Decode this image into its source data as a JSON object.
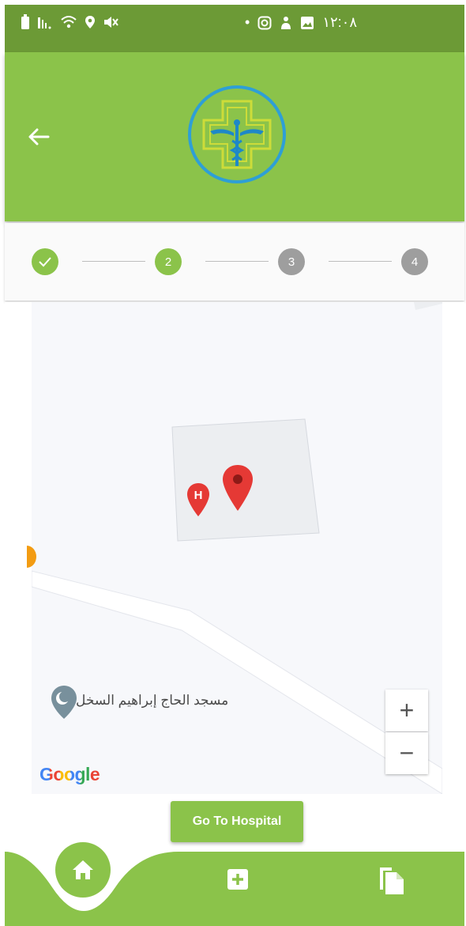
{
  "status_bar": {
    "time": "١٢:٠٨",
    "dot": "•"
  },
  "stepper": {
    "steps": [
      {
        "label": "",
        "state": "completed"
      },
      {
        "label": "2",
        "state": "active"
      },
      {
        "label": "3",
        "state": "pending"
      },
      {
        "label": "4",
        "state": "pending"
      }
    ]
  },
  "map": {
    "place_label": "مسجد الحاج إبراهيم السخل",
    "attribution": "Google",
    "zoom_in": "+",
    "zoom_out": "−",
    "hospital_marker_letter": "H"
  },
  "action": {
    "go_to_hospital": "Go To Hospital"
  },
  "colors": {
    "primary": "#8bc34a",
    "status_bar": "#6c9a36",
    "pending_step": "#9e9e9e",
    "marker_red": "#e53935"
  },
  "nav": {
    "items": [
      "home-icon",
      "add-box-icon",
      "documents-icon"
    ]
  }
}
